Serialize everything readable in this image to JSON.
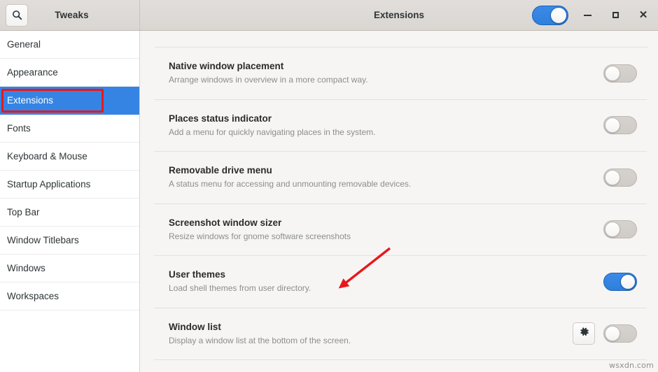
{
  "titlebar": {
    "app_title": "Tweaks",
    "page_title": "Extensions",
    "search_icon": "search-icon",
    "master_switch_on": true,
    "window_controls": {
      "minimize": "minimize-icon",
      "maximize": "maximize-icon",
      "close": "close-icon"
    }
  },
  "sidebar": {
    "items": [
      {
        "label": "General",
        "selected": false
      },
      {
        "label": "Appearance",
        "selected": false
      },
      {
        "label": "Extensions",
        "selected": true
      },
      {
        "label": "Fonts",
        "selected": false
      },
      {
        "label": "Keyboard & Mouse",
        "selected": false
      },
      {
        "label": "Startup Applications",
        "selected": false
      },
      {
        "label": "Top Bar",
        "selected": false
      },
      {
        "label": "Window Titlebars",
        "selected": false
      },
      {
        "label": "Windows",
        "selected": false
      },
      {
        "label": "Workspaces",
        "selected": false
      }
    ]
  },
  "extensions": [
    {
      "name": "Native window placement",
      "description": "Arrange windows in overview in a more compact way.",
      "enabled": false,
      "has_settings": false
    },
    {
      "name": "Places status indicator",
      "description": "Add a menu for quickly navigating places in the system.",
      "enabled": false,
      "has_settings": false
    },
    {
      "name": "Removable drive menu",
      "description": "A status menu for accessing and unmounting removable devices.",
      "enabled": false,
      "has_settings": false
    },
    {
      "name": "Screenshot window sizer",
      "description": "Resize windows for gnome software screenshots",
      "enabled": false,
      "has_settings": false
    },
    {
      "name": "User themes",
      "description": "Load shell themes from user directory.",
      "enabled": true,
      "has_settings": false
    },
    {
      "name": "Window list",
      "description": "Display a window list at the bottom of the screen.",
      "enabled": false,
      "has_settings": true
    }
  ],
  "annotations": {
    "highlight_target": "Extensions",
    "arrow_target": "User themes",
    "color": "#e8171b"
  },
  "watermark": "wsxdn.com"
}
